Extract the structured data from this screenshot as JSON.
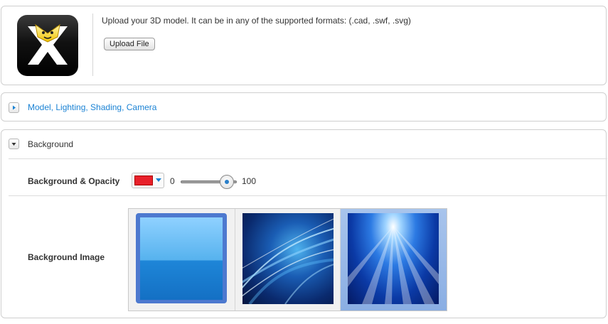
{
  "upload": {
    "description": "Upload your 3D model. It can be in any of the supported formats: (.cad, .swf, .svg)",
    "button_label": "Upload File",
    "logo_icon": "wix-logo-icon"
  },
  "model_section": {
    "label": "Model, Lighting, Shading, Camera",
    "expanded": false,
    "link_color": "#1a82d4"
  },
  "background_section": {
    "title": "Background",
    "expanded": true,
    "opacity": {
      "label": "Background & Opacity",
      "color": "#e8202a",
      "min_label": "0",
      "max_label": "100",
      "value_fraction": 0.82
    },
    "image": {
      "label": "Background Image",
      "options": [
        {
          "name": "blue-gradient"
        },
        {
          "name": "blue-abstract-waves"
        },
        {
          "name": "blue-light-rays"
        }
      ],
      "selected_index": 2,
      "selection_color": "#a8c4ec"
    }
  }
}
